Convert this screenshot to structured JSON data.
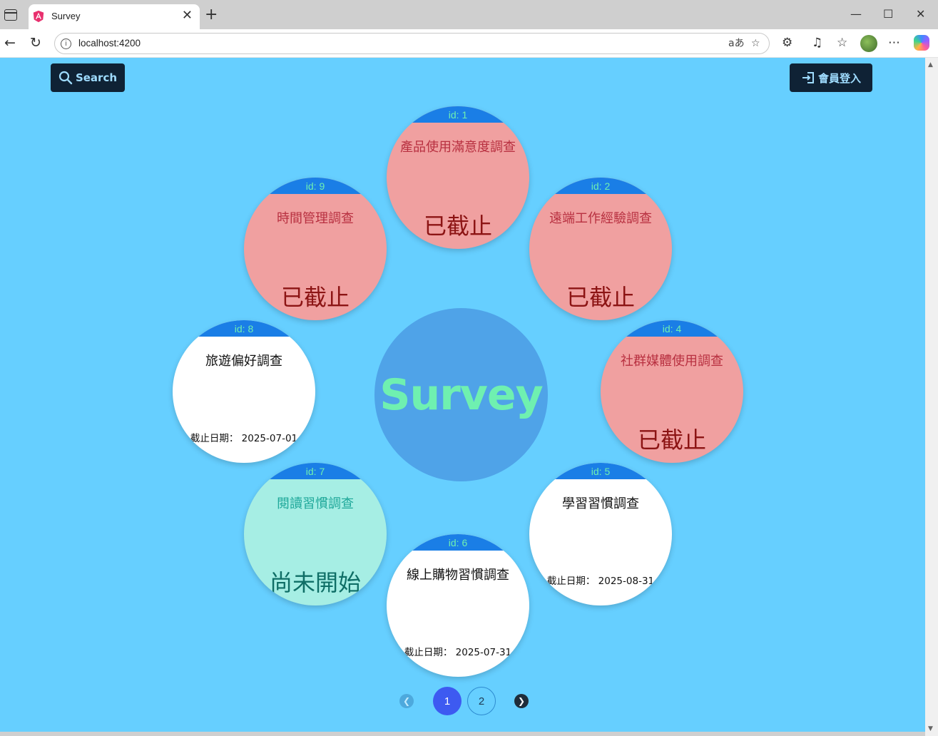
{
  "browser": {
    "tab_title": "Survey",
    "url": "localhost:4200"
  },
  "header": {
    "search_label": "Search",
    "login_label": "會員登入"
  },
  "center": {
    "title": "Survey"
  },
  "surveys": [
    {
      "id_label": "id: 1",
      "title": "產品使用滿意度調查",
      "state": "closed",
      "status": "已截止"
    },
    {
      "id_label": "id: 2",
      "title": "遠端工作經驗調查",
      "state": "closed",
      "status": "已截止"
    },
    {
      "id_label": "id: 4",
      "title": "社群媒體使用調查",
      "state": "closed",
      "status": "已截止"
    },
    {
      "id_label": "id: 5",
      "title": "學習習慣調查",
      "state": "open",
      "deadline": "截止日期： 2025-08-31"
    },
    {
      "id_label": "id: 6",
      "title": "線上購物習慣調查",
      "state": "open",
      "deadline": "截止日期： 2025-07-31"
    },
    {
      "id_label": "id: 7",
      "title": "閱讀習慣調查",
      "state": "notstarted",
      "status": "尚未開始"
    },
    {
      "id_label": "id: 8",
      "title": "旅遊偏好調查",
      "state": "open",
      "deadline": "截止日期： 2025-07-01"
    },
    {
      "id_label": "id: 9",
      "title": "時間管理調查",
      "state": "closed",
      "status": "已截止"
    }
  ],
  "pagination": {
    "pages": [
      "1",
      "2"
    ],
    "current": "1"
  },
  "colors": {
    "page_bg": "#66cfff",
    "closed_card": "#f0a0a0",
    "open_card": "#ffffff",
    "notstarted_card": "#a6eee4",
    "id_header": "#1a7ee6",
    "center_circle": "#4fa3e8",
    "center_text": "#6ff0b0"
  }
}
